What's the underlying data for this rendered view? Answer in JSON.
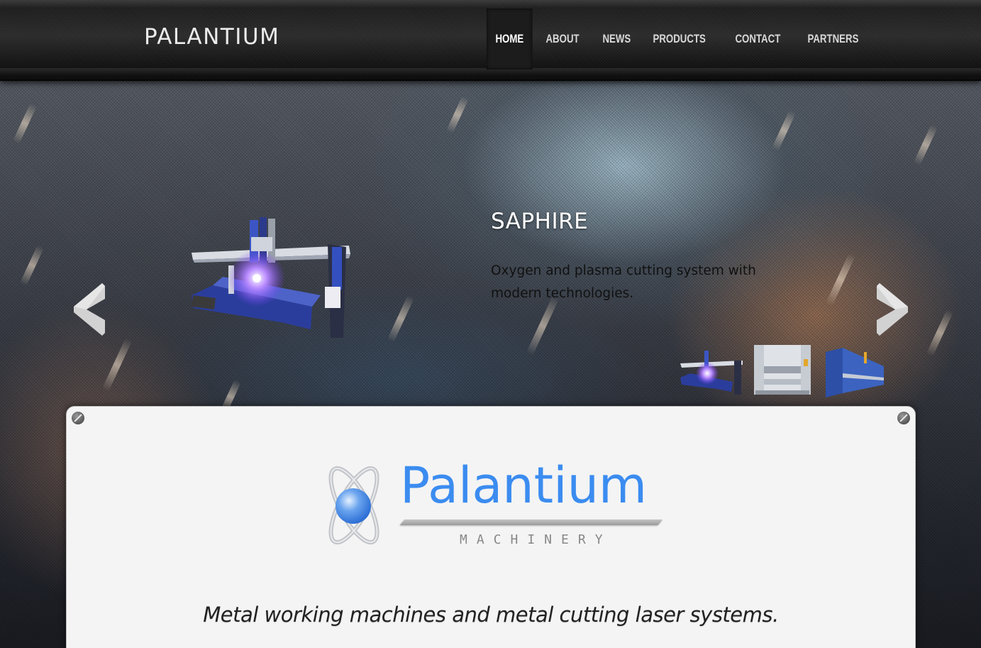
{
  "header": {
    "brand": "PALANTIUM",
    "nav": [
      {
        "label": "HOME",
        "active": true
      },
      {
        "label": "ABOUT",
        "active": false
      },
      {
        "label": "NEWS",
        "active": false
      },
      {
        "label": "PRODUCTS",
        "active": false
      },
      {
        "label": "CONTACT",
        "active": false
      },
      {
        "label": "PARTNERS",
        "active": false
      }
    ]
  },
  "slider": {
    "title": "SAPHIRE",
    "description": "Oxygen and plasma cutting system with modern technologies.",
    "prev_icon": "chevron-left-icon",
    "next_icon": "chevron-right-icon",
    "thumbnails": [
      "plasma-cutter-thumbnail",
      "press-brake-thumbnail",
      "blue-press-brake-thumbnail"
    ]
  },
  "content": {
    "logo_name": "Palantium",
    "logo_sub": "MACHINERY",
    "tagline": "Metal working machines and metal cutting laser systems."
  },
  "colors": {
    "accent": "#3b8cf0",
    "header": "#1e1e1e",
    "panel": "#f4f4f4"
  }
}
